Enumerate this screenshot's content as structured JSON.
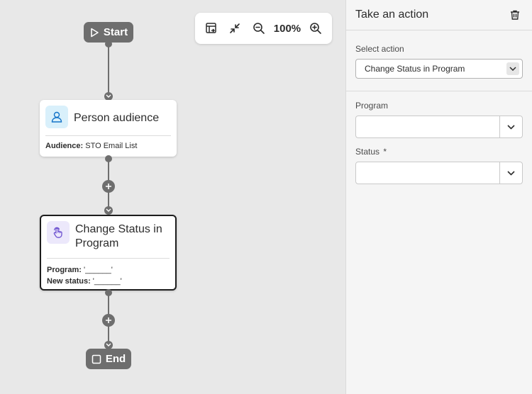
{
  "toolbar": {
    "zoom": "100%"
  },
  "flow": {
    "start_label": "Start",
    "end_label": "End",
    "nodes": [
      {
        "title": "Person audience",
        "meta": [
          {
            "key": "Audience:",
            "value": " STO Email List"
          }
        ]
      },
      {
        "title": "Change Status in Program",
        "meta": [
          {
            "key": "Program:",
            "value": " '______'"
          },
          {
            "key": "New status:",
            "value": " '______'"
          }
        ]
      }
    ]
  },
  "panel": {
    "title": "Take an action",
    "select_action_label": "Select action",
    "select_action_value": "Change Status in Program",
    "program_label": "Program",
    "status_label": "Status",
    "status_required_mark": "*"
  },
  "colors": {
    "node_gray": "#6e6e6e",
    "audience_icon_bg": "#d9f0fb",
    "action_icon_bg": "#ece8fb"
  }
}
